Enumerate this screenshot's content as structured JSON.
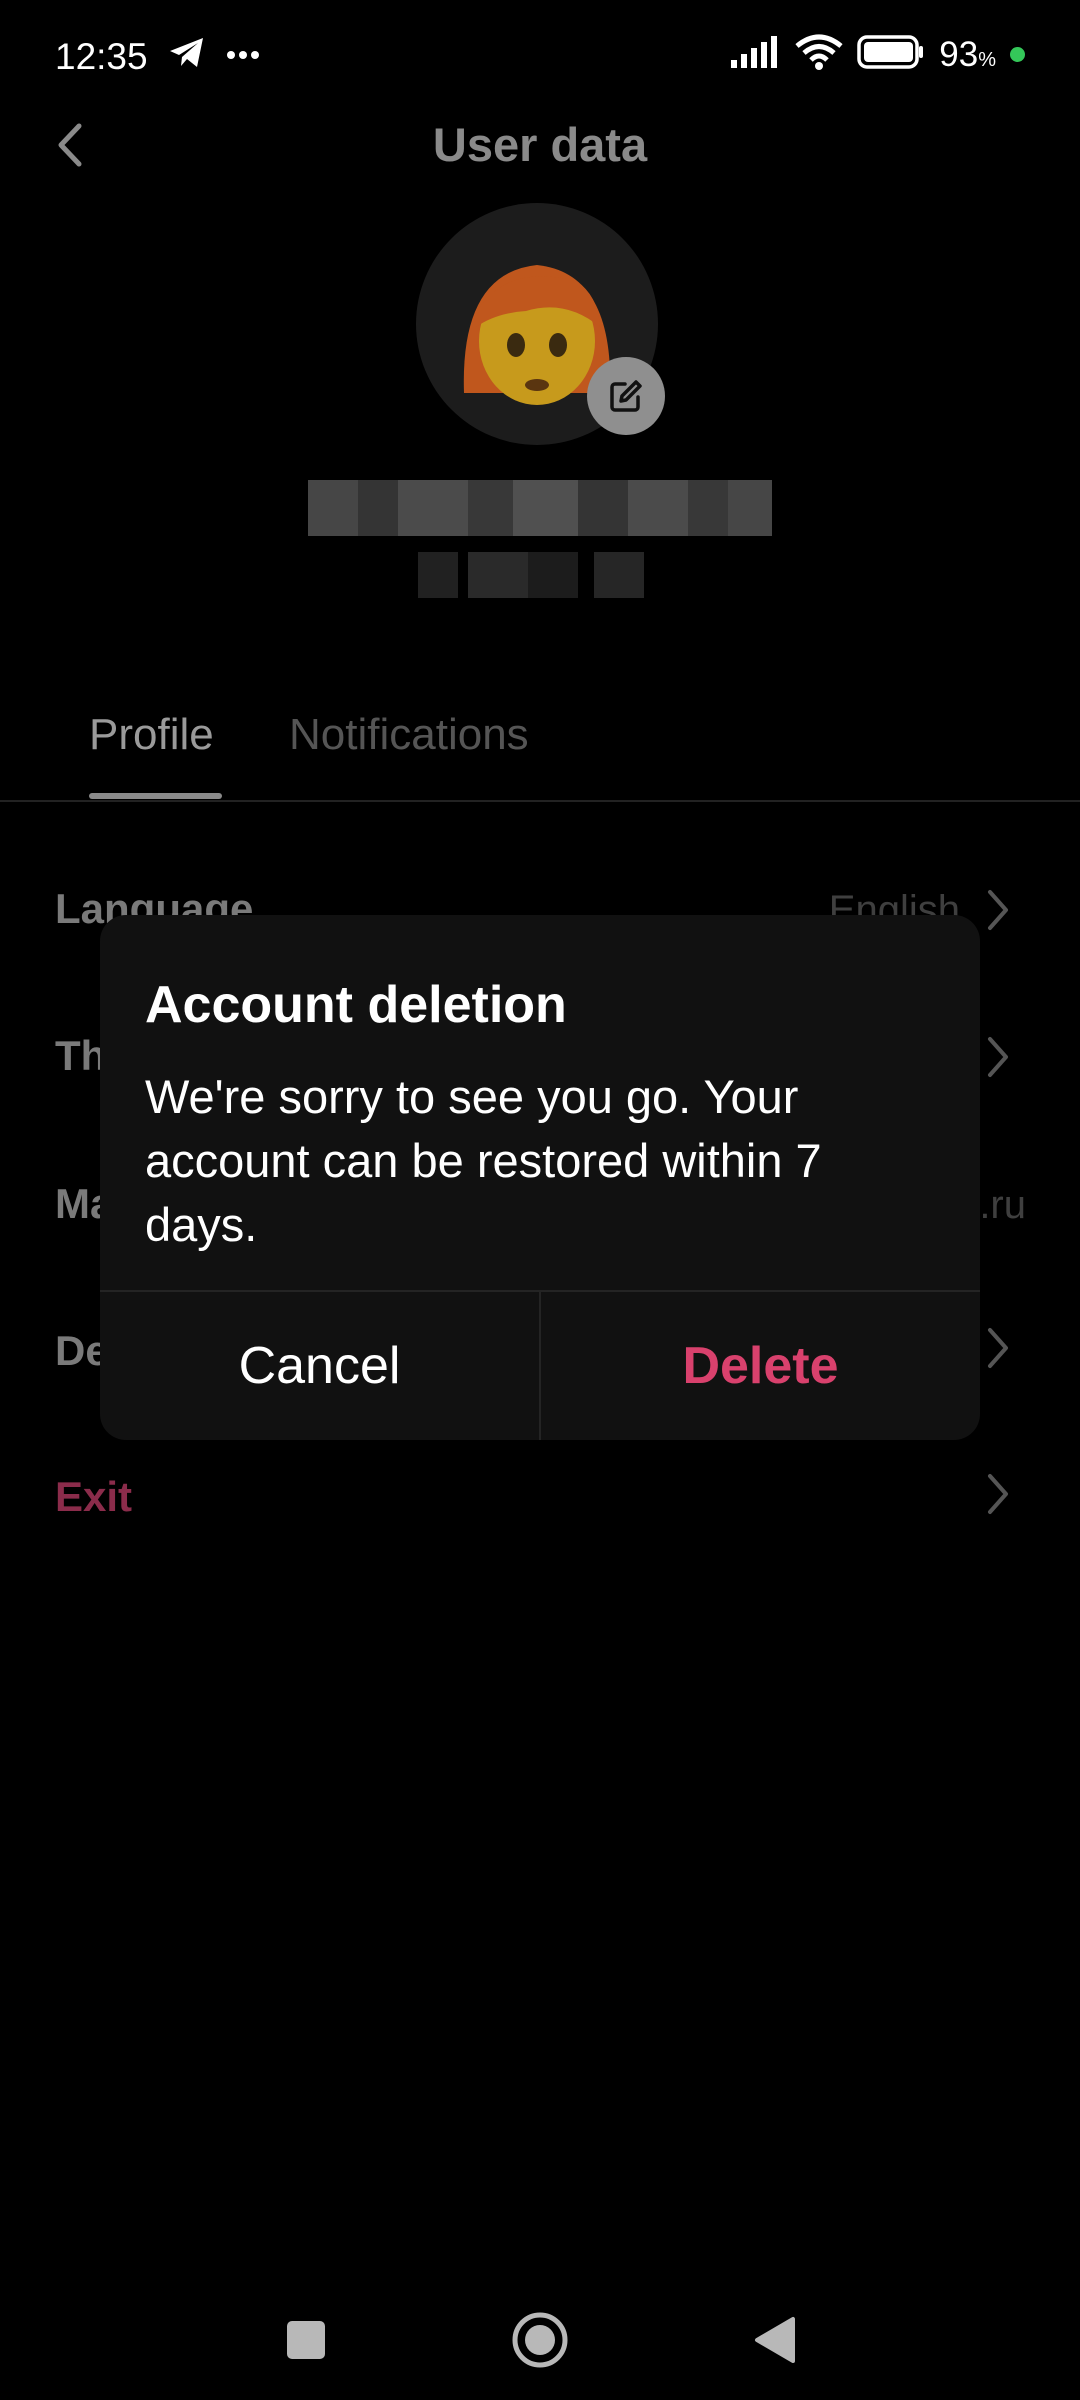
{
  "status_bar": {
    "time": "12:35",
    "battery": "93",
    "battery_unit": "%",
    "icons": [
      "telegram-icon",
      "more-dots-icon",
      "signal-icon",
      "wifi-icon",
      "battery-icon"
    ]
  },
  "header": {
    "title": "User data",
    "back_icon": "chevron-left-icon"
  },
  "profile": {
    "avatar_icon": "woman-red-hair-emoji",
    "edit_icon": "edit-icon"
  },
  "tabs": [
    {
      "label": "Profile",
      "active": true
    },
    {
      "label": "Notifications",
      "active": false
    }
  ],
  "settings_rows": [
    {
      "label": "Language",
      "value": "English"
    },
    {
      "label": "Th",
      "value": ""
    },
    {
      "label": "Ma",
      "value": ".ru"
    },
    {
      "label": "De",
      "value": ""
    },
    {
      "label": "Exit",
      "value": ""
    }
  ],
  "dialog": {
    "title": "Account deletion",
    "message": "We're sorry to see you go. Your account can be restored within 7 days.",
    "cancel_label": "Cancel",
    "delete_label": "Delete"
  },
  "colors": {
    "background": "#000000",
    "dialog": "#111111",
    "delete_accent": "#d9416d",
    "exit_accent": "#8b2c4b",
    "status_dot": "#34c759"
  },
  "nav_bar": [
    "recents-square-icon",
    "home-circle-icon",
    "back-triangle-icon"
  ]
}
